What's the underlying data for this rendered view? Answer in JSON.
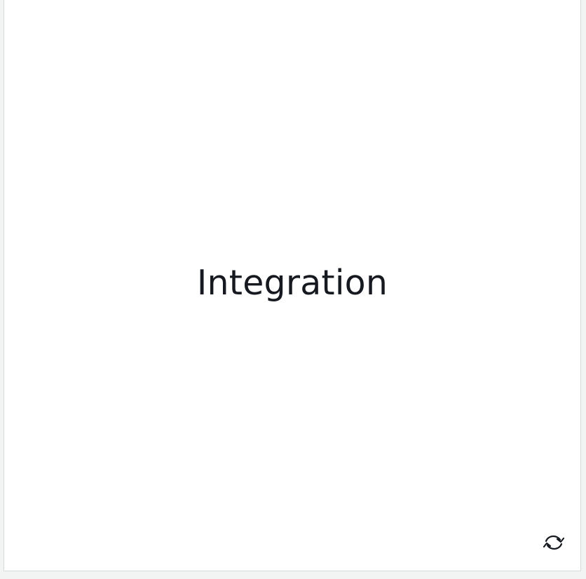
{
  "card": {
    "title": "Integration",
    "flip_icon": "refresh-icon"
  },
  "colors": {
    "page_background": "#f2f3f3",
    "card_background": "#ffffff",
    "card_border": "#d5dbdb",
    "text": "#16191f"
  }
}
